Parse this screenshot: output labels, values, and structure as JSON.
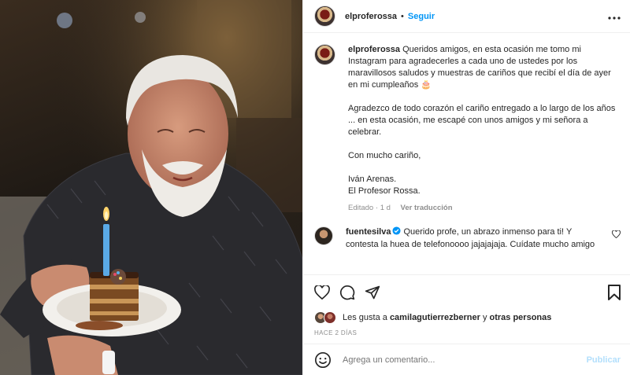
{
  "post": {
    "username": "elproferossa",
    "separator": "•",
    "follow_label": "Seguir",
    "more_icon": "more-options-icon",
    "image": {
      "subject": "photo",
      "colors": {
        "background": "#2b241c",
        "shirt": "#2a2a2e",
        "plate": "#f2f0ec",
        "candle": "#5aa9e6",
        "flame": "#ffd36b"
      }
    }
  },
  "caption": {
    "username": "elproferossa",
    "text": "Queridos amigos, en esta ocasión me tomo mi Instagram para agradecerles a cada uno de ustedes por los maravillosos saludos y muestras de cariños que recibí el día de ayer en mi cumpleaños 🎂",
    "paragraph2": "Agradezco de todo corazón el cariño entregado a lo largo de los años ... en esta ocasión, me escapé con unos amigos y mi señora a celebrar.",
    "paragraph3": "Con mucho cariño,",
    "signature1": "Iván Arenas.",
    "signature2": "El Profesor Rossa.",
    "edited": "Editado",
    "dot": "·",
    "time": "1 d",
    "translate_label": "Ver traducción"
  },
  "comment": {
    "username": "fuentesilva",
    "verified": true,
    "text": "Querido profe, un abrazo inmenso para ti! Y contesta la huea de telefonoooo jajajajaja. Cuídate mucho amigo"
  },
  "likes": {
    "prefix": "Les gusta a",
    "user": "camilagutierrezberner",
    "connector": "y",
    "others": "otras personas"
  },
  "posted_ago": "HACE 2 DÍAS",
  "add_comment": {
    "placeholder": "Agrega un comentario...",
    "publish_label": "Publicar"
  },
  "colors": {
    "accent": "#0095f6",
    "publish_disabled": "#b2dffc",
    "muted": "#8e8e8e",
    "text": "#262626"
  }
}
